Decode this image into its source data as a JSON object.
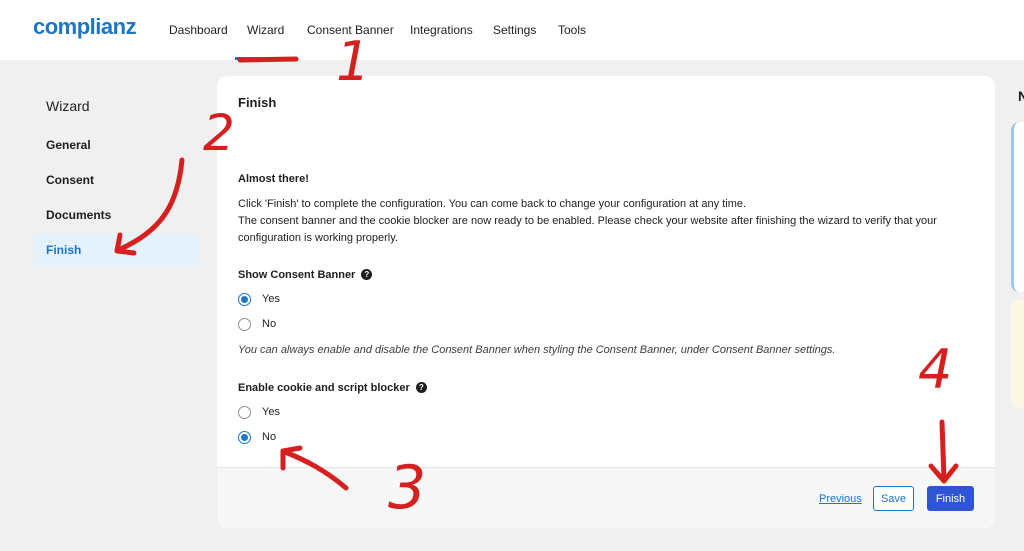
{
  "app": {
    "logo": "complianz"
  },
  "nav": {
    "items": [
      "Dashboard",
      "Wizard",
      "Consent Banner",
      "Integrations",
      "Settings",
      "Tools"
    ],
    "active": "Wizard"
  },
  "sidebar": {
    "title": "Wizard",
    "items": [
      "General",
      "Consent",
      "Documents",
      "Finish"
    ],
    "active": "Finish"
  },
  "card": {
    "title": "Finish",
    "heading": "Almost there!",
    "para1": "Click 'Finish' to complete the configuration. You can come back to change your configuration at any time.",
    "para2_line1": "The consent banner and the cookie blocker are now ready to be enabled. Please check your website after finishing the wizard to verify that your",
    "para2_line2": "configuration is working properly.",
    "show_banner": {
      "label": "Show Consent Banner",
      "help": "?",
      "options": [
        "Yes",
        "No"
      ],
      "selected": "Yes"
    },
    "note": "You can always enable and disable the Consent Banner when styling the Consent Banner, under Consent Banner settings.",
    "blocker": {
      "label": "Enable cookie and script blocker",
      "help": "?",
      "options": [
        "Yes",
        "No"
      ],
      "selected": "No"
    }
  },
  "footer": {
    "previous": "Previous",
    "save": "Save",
    "finish": "Finish"
  },
  "right_panel": {
    "letter": "N"
  },
  "annotations": {
    "numbers": [
      "1",
      "2",
      "3",
      "4"
    ],
    "color": "#d62020"
  },
  "colors": {
    "accent": "#1b76c8",
    "finish_button": "#2f55d4",
    "background": "#f0f0f1"
  }
}
